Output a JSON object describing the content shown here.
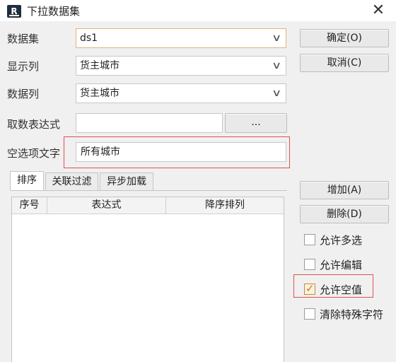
{
  "window": {
    "title": "下拉数据集",
    "close_glyph": "✕"
  },
  "form": {
    "dataset_label": "数据集",
    "dataset_value": "ds1",
    "display_col_label": "显示列",
    "display_col_value": "货主城市",
    "data_col_label": "数据列",
    "data_col_value": "货主城市",
    "expr_label": "取数表达式",
    "expr_value": "",
    "expr_button": "...",
    "empty_label": "空选项文字",
    "empty_value": "所有城市",
    "chevron": "∨"
  },
  "buttons": {
    "ok": "确定(O)",
    "cancel": "取消(C)",
    "add": "增加(A)",
    "delete": "删除(D)"
  },
  "tabs": [
    "排序",
    "关联过滤",
    "异步加载"
  ],
  "table": {
    "columns": [
      "序号",
      "表达式",
      "降序排列"
    ]
  },
  "options": [
    {
      "label": "允许多选",
      "checked": false
    },
    {
      "label": "允许编辑",
      "checked": false
    },
    {
      "label": "允许空值",
      "checked": true
    },
    {
      "label": "清除特殊字符",
      "checked": false
    }
  ],
  "colors": {
    "highlight_frame": "#d9534f",
    "check_accent": "#c97b17"
  }
}
